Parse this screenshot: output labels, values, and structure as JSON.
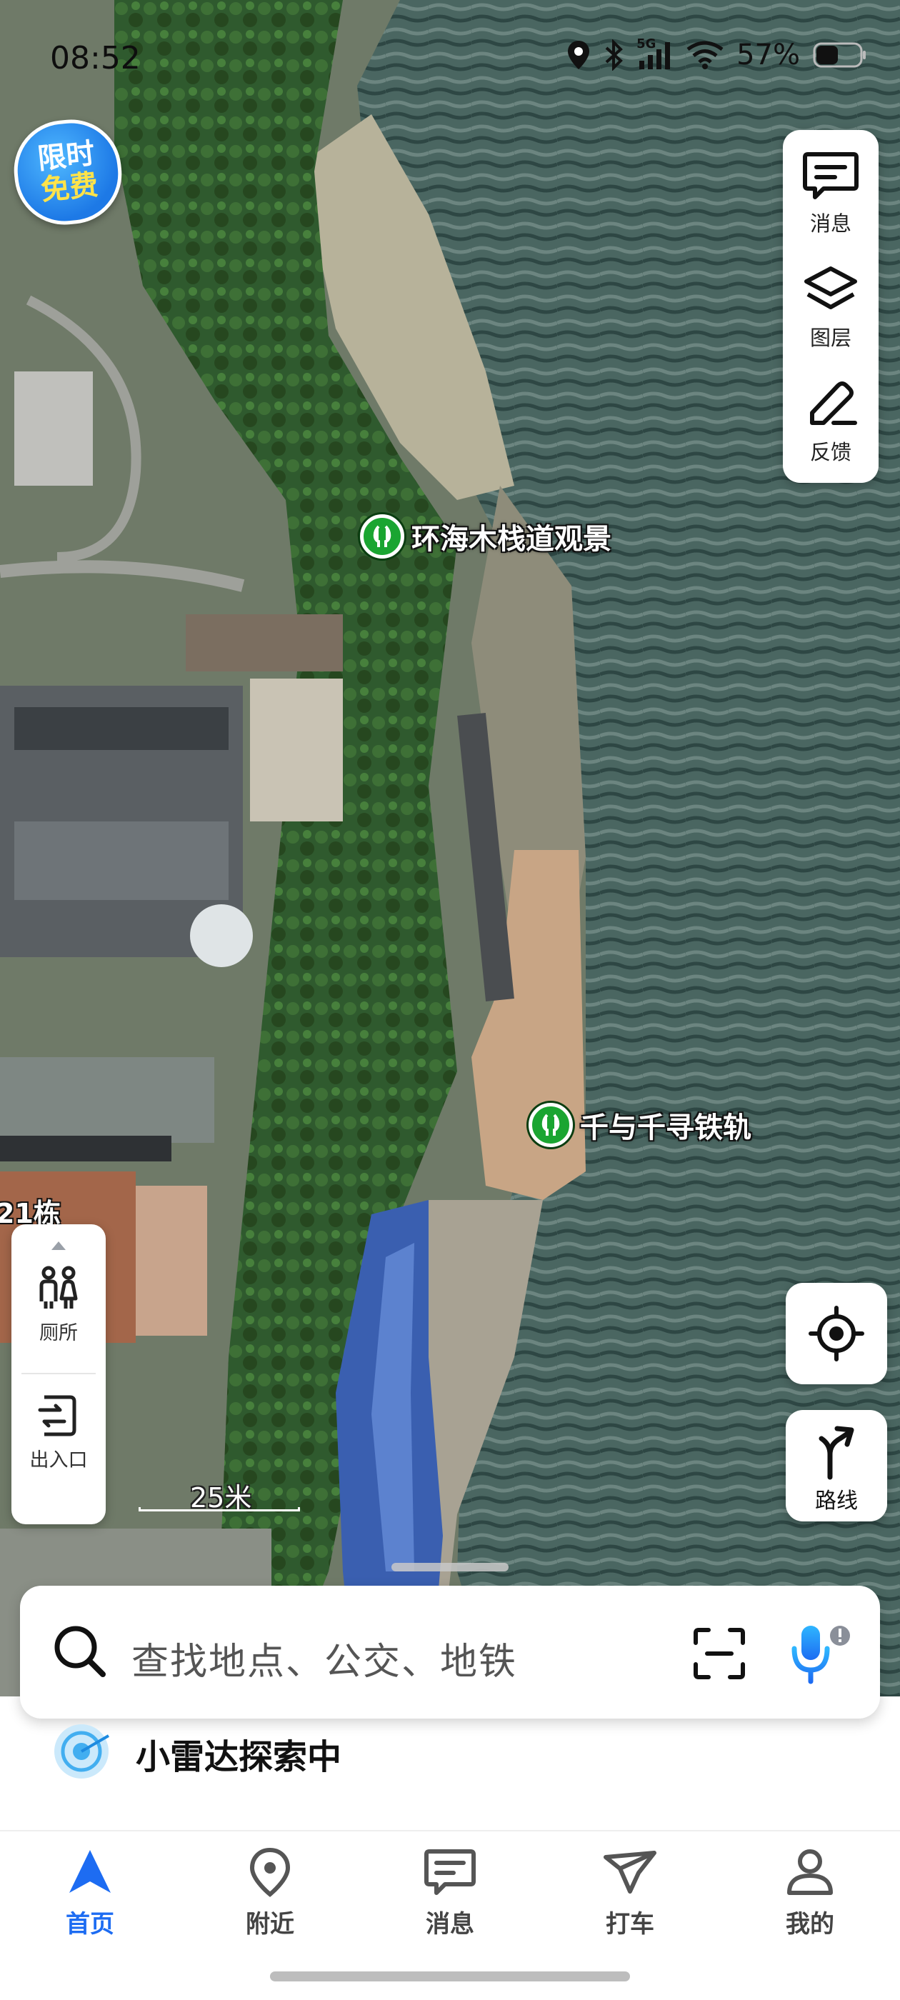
{
  "status_bar": {
    "time": "08:52",
    "network": "5G",
    "battery_percent": "57%",
    "icons": [
      "location-icon",
      "bluetooth-icon",
      "signal-icon",
      "wifi-icon",
      "battery-icon"
    ]
  },
  "promo_badge": {
    "line1": "限时",
    "line2": "免费"
  },
  "right_tools": [
    {
      "label": "消息",
      "icon": "message-icon"
    },
    {
      "label": "图层",
      "icon": "layers-icon"
    },
    {
      "label": "反馈",
      "icon": "feedback-pen-icon"
    }
  ],
  "map": {
    "pois": [
      {
        "name": "环海木栈道观景",
        "icon": "scenic-spot-icon"
      },
      {
        "name": "千与千寻铁轨",
        "icon": "scenic-spot-icon"
      }
    ],
    "building_label": "21栋",
    "scale_label": "25米"
  },
  "left_panel": {
    "items": [
      {
        "label": "厕所",
        "icon": "toilet-icon"
      },
      {
        "label": "出入口",
        "icon": "entrance-icon"
      }
    ]
  },
  "route_button": {
    "label": "路线"
  },
  "search": {
    "placeholder": "查找地点、公交、地铁"
  },
  "radar": {
    "text": "小雷达探索中"
  },
  "tabs": [
    {
      "label": "首页",
      "icon": "navigation-arrow-icon",
      "active": true
    },
    {
      "label": "附近",
      "icon": "location-pin-icon",
      "active": false
    },
    {
      "label": "消息",
      "icon": "chat-bubble-icon",
      "active": false
    },
    {
      "label": "打车",
      "icon": "taxi-icon",
      "active": false
    },
    {
      "label": "我的",
      "icon": "profile-icon",
      "active": false
    }
  ],
  "colors": {
    "accent": "#1d6cf2",
    "poi_green": "#1aa531",
    "sea": "#3d5a56"
  }
}
